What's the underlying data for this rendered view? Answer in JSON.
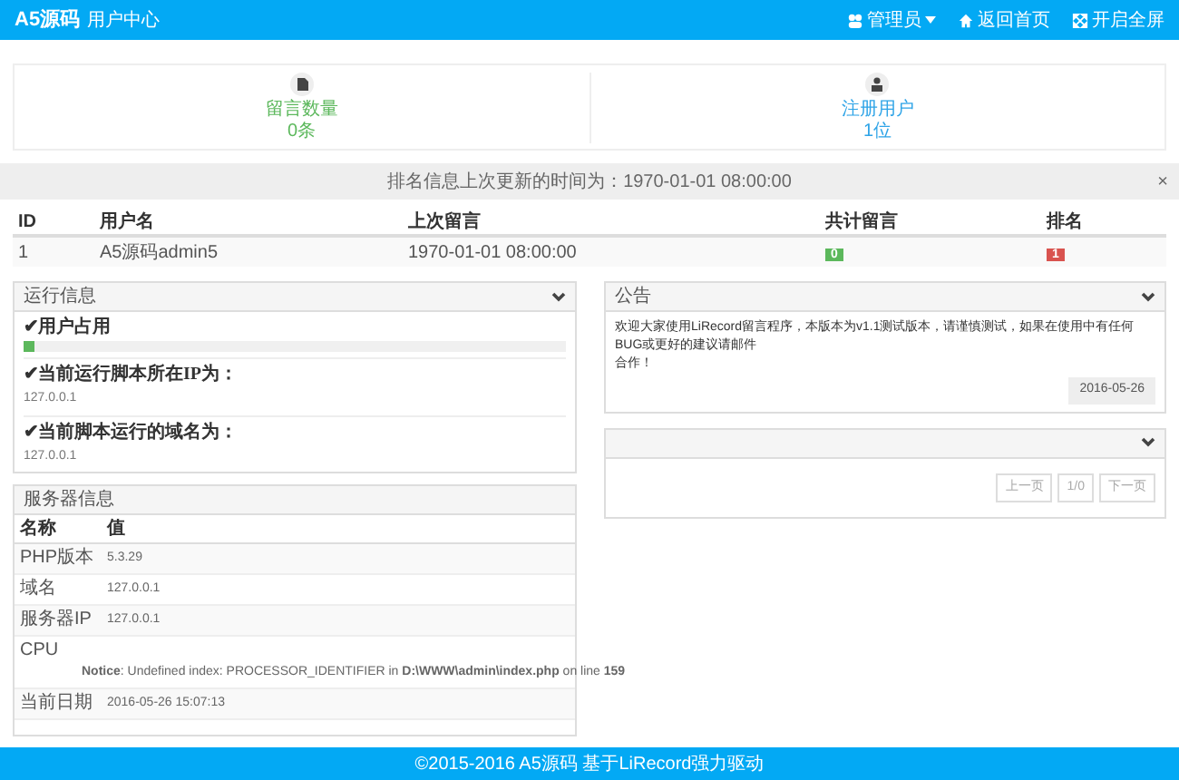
{
  "header": {
    "logo": "A5源码",
    "subtitle": "用户中心",
    "menu": [
      {
        "kind": "user",
        "label": "管理员",
        "dropdown": true
      },
      {
        "kind": "home",
        "label": "返回首页",
        "dropdown": false
      },
      {
        "kind": "fullscreen",
        "label": "开启全屏",
        "dropdown": false
      }
    ]
  },
  "stats": [
    {
      "kind": "doc",
      "label": "留言数量",
      "value": "0条",
      "color": "#5cb85c"
    },
    {
      "kind": "user",
      "label": "注册用户",
      "value": "1位",
      "color": "#2fa4e7"
    }
  ],
  "alert": {
    "text": "排名信息上次更新的时间为：1970-01-01 08:00:00",
    "close": "×"
  },
  "table": {
    "columns": [
      "ID",
      "用户名",
      "上次留言",
      "共计留言",
      "排名"
    ],
    "rows": [
      {
        "cells": [
          "1",
          "A5源码admin5",
          "1970-01-01 08:00:00"
        ],
        "count": "0",
        "rank": "1"
      }
    ]
  },
  "run_panel": {
    "title": "运行信息",
    "items": [
      {
        "kind": "meter",
        "label": "✔用户占用",
        "level": 0.02
      },
      {
        "kind": "text",
        "label": "✔当前运行脚本所在IP为：",
        "value": "127.0.0.1"
      },
      {
        "kind": "text",
        "label": "✔当前脚本运行的域名为：",
        "value": "127.0.0.1"
      }
    ]
  },
  "notice_panel": {
    "title": "公告",
    "lines": [
      "欢迎大家使用LiRecord留言程序，本版本为v1.1测试版本，请谨慎测试，如果在使用中有任何BUG或更好的建议请邮件",
      "合作！"
    ],
    "date": "2016-05-26"
  },
  "pager": {
    "buttons": [
      "上一页",
      "1/0",
      "下一页"
    ]
  },
  "server_panel": {
    "title": "服务器信息",
    "columns": [
      "名称",
      "值"
    ],
    "rows": [
      [
        "PHP版本",
        "5.3.29"
      ],
      [
        "域名",
        "127.0.0.1"
      ],
      [
        "服务器IP",
        "127.0.0.1"
      ],
      [
        "CPU",
        "**Notice**: Undefined index: PROCESSOR_IDENTIFIER in **D:\\WWW\\admin\\index.php** on line **159**"
      ],
      [
        "当前日期",
        "2016-05-26 15:07:13"
      ]
    ]
  },
  "footer": "©2015-2016 A5源码 基于LiRecord强力驱动"
}
